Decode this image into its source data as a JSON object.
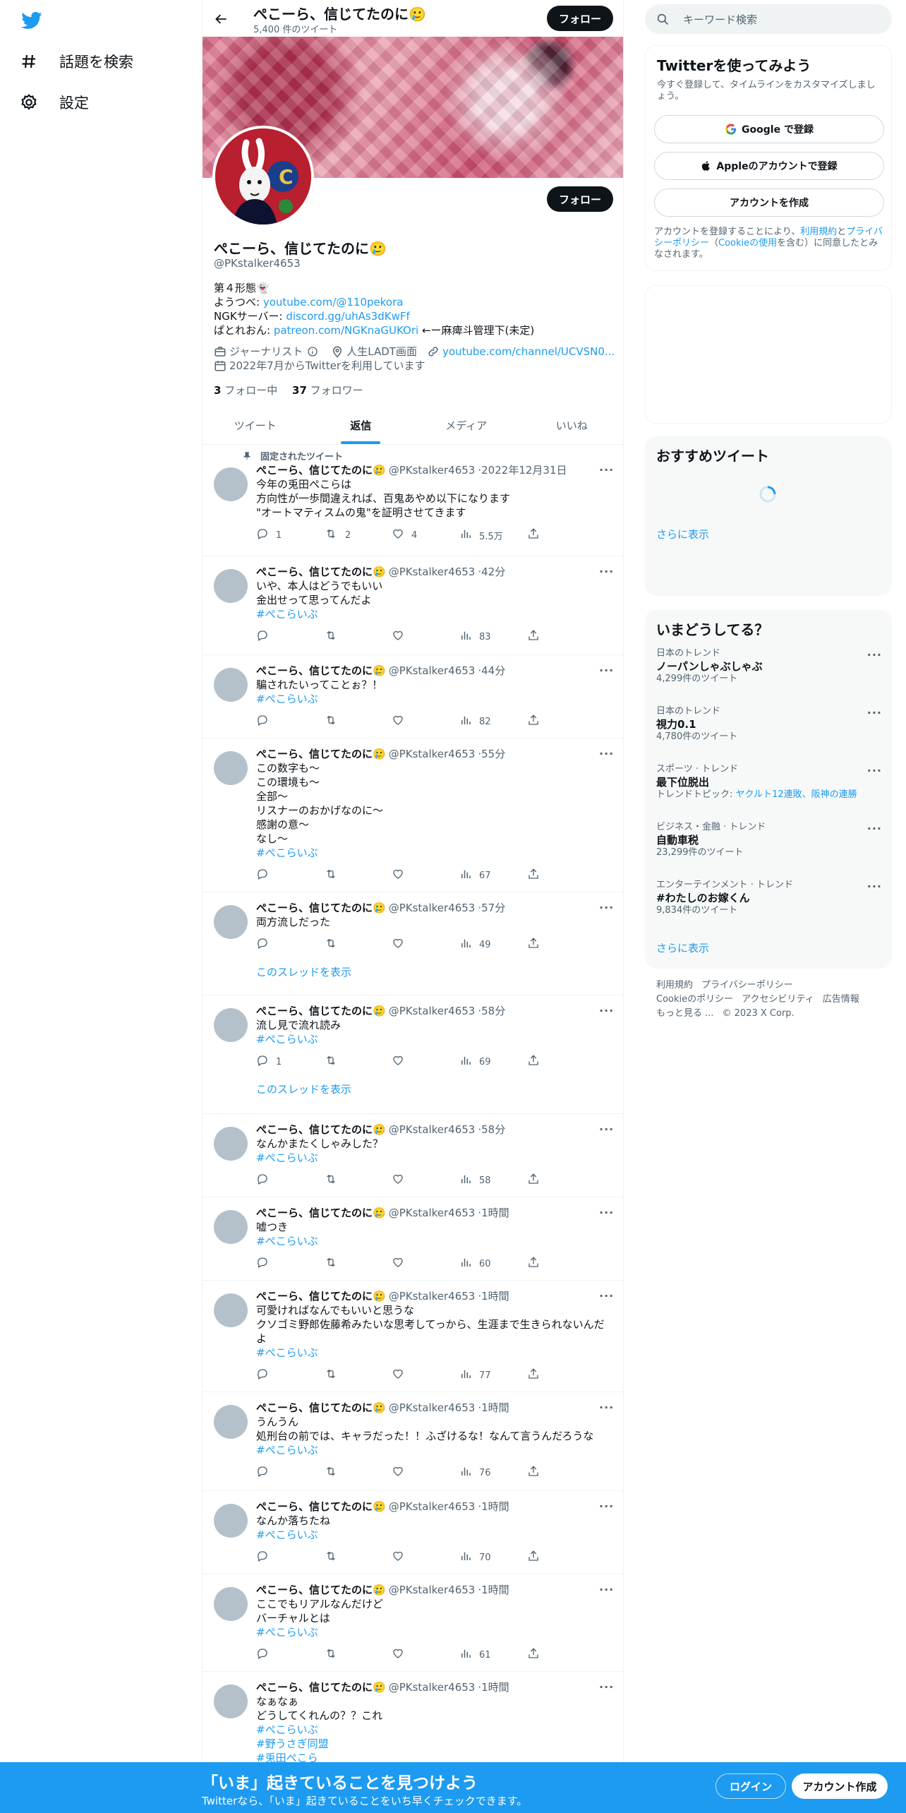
{
  "nav": {
    "explore_label": "話題を検索",
    "settings_label": "設定"
  },
  "profile": {
    "name": "ぺこーら、信じてたのに🥲",
    "tweet_count": "5,400 件のツイート",
    "follow_label": "フォロー",
    "handle": "@PKstalker4653",
    "bio": {
      "line1": "第４形態👻",
      "line2_prefix": "ようつべ: ",
      "line2_link": "youtube.com/@110pekora",
      "line3_prefix": "NGKサーバー: ",
      "line3_link": "discord.gg/uhAs3dKwFf",
      "line4_prefix": "ぱとれおん: ",
      "line4_link": "patreon.com/NGKnaGUKOri",
      "line4_suffix": " ←ー麻痺斗管理下(未定)"
    },
    "category": "ジャーナリスト",
    "location": "人生LADT画面",
    "website": "youtube.com/channel/UCVSN0...",
    "joined": "2022年7月からTwitterを利用しています",
    "following_count": "3",
    "following_label": "フォロー中",
    "followers_count": "37",
    "followers_label": "フォロワー"
  },
  "tabs": [
    "ツイート",
    "返信",
    "メディア",
    "いいね"
  ],
  "active_tab": "返信",
  "pinned_label": "固定されたツイート",
  "show_thread_label": "このスレッドを表示",
  "tweets": [
    {
      "time": "2022年12月31日",
      "lines": [
        "今年の兎田ぺこらは",
        "方向性が一歩間違えれば、百鬼あやめ以下になります",
        "\"オートマティスムの鬼\"を証明させてきます"
      ],
      "tags": [],
      "replies": "1",
      "retweets": "2",
      "likes": "4",
      "views": "5.5万"
    },
    {
      "time": "42分",
      "lines": [
        "いや、本人はどうでもいい",
        "金出せって思ってんだよ"
      ],
      "tags": [
        "#ぺこらいぶ"
      ],
      "replies": "",
      "retweets": "",
      "likes": "",
      "views": "83"
    },
    {
      "time": "44分",
      "lines": [
        "騙されたいってことぉ？！"
      ],
      "tags": [
        "#ぺこらいぶ"
      ],
      "replies": "",
      "retweets": "",
      "likes": "",
      "views": "82"
    },
    {
      "time": "55分",
      "lines": [
        "この数字も〜",
        "この環境も〜",
        "全部〜",
        "リスナーのおかげなのに〜",
        "感謝の意〜",
        "なし〜"
      ],
      "tags": [
        "#ぺこらいぶ"
      ],
      "replies": "",
      "retweets": "",
      "likes": "",
      "views": "67"
    },
    {
      "time": "57分",
      "lines": [
        "両方流しだった"
      ],
      "tags": [],
      "replies": "",
      "retweets": "",
      "likes": "",
      "views": "49"
    },
    {
      "time": "58分",
      "lines": [
        "流し見で流れ読み"
      ],
      "tags": [
        "#ぺこらいぶ"
      ],
      "replies": "1",
      "retweets": "",
      "likes": "",
      "views": "69"
    },
    {
      "time": "58分",
      "lines": [
        "なんかまたくしゃみした？"
      ],
      "tags": [
        "#ぺこらいぶ"
      ],
      "replies": "",
      "retweets": "",
      "likes": "",
      "views": "58"
    },
    {
      "time": "1時間",
      "lines": [
        "嘘つき"
      ],
      "tags": [
        "#ぺこらいぶ"
      ],
      "replies": "",
      "retweets": "",
      "likes": "",
      "views": "60"
    },
    {
      "time": "1時間",
      "lines": [
        "可愛ければなんでもいいと思うな",
        "クソゴミ野郎佐藤希みたいな思考してっから、生涯まで生きられないんだよ"
      ],
      "tags": [
        "#ぺこらいぶ"
      ],
      "replies": "",
      "retweets": "",
      "likes": "",
      "views": "77"
    },
    {
      "time": "1時間",
      "lines": [
        "うんうん",
        "処刑台の前では、キャラだった！！ふざけるな！なんて言うんだろうな"
      ],
      "tags": [
        "#ぺこらいぶ"
      ],
      "replies": "",
      "retweets": "",
      "likes": "",
      "views": "76"
    },
    {
      "time": "1時間",
      "lines": [
        "なんか落ちたね"
      ],
      "tags": [
        "#ぺこらいぶ"
      ],
      "replies": "",
      "retweets": "",
      "likes": "",
      "views": "70"
    },
    {
      "time": "1時間",
      "lines": [
        "ここでもリアルなんだけど",
        "バーチャルとは"
      ],
      "tags": [
        "#ぺこらいぶ"
      ],
      "replies": "",
      "retweets": "",
      "likes": "",
      "views": "61"
    },
    {
      "time": "1時間",
      "lines": [
        "なぁなぁ",
        "どうしてくれんの？？これ"
      ],
      "tags": [
        "#ぺこらいぶ",
        "#野うさぎ同盟",
        "#兎田ぺこら"
      ],
      "replies": "",
      "retweets": "",
      "likes": "",
      "views": ""
    }
  ],
  "search": {
    "placeholder": "キーワード検索"
  },
  "signup": {
    "title": "Twitterを使ってみよう",
    "desc": "今すぐ登録して、タイムラインをカスタマイズしましょう。",
    "google": "Google で登録",
    "apple": "Appleのアカウントで登録",
    "create": "アカウントを作成",
    "terms_1": "アカウントを登録することにより、",
    "terms_link1": "利用規約",
    "terms_2": "と",
    "terms_link2": "プライバシーポリシー",
    "terms_3": "（",
    "terms_link3": "Cookieの使用",
    "terms_4": "を含む）に同意したとみなされます。"
  },
  "recommend": {
    "title": "おすすめツイート",
    "more": "さらに表示"
  },
  "trends": {
    "title": "いまどうしてる？",
    "items": [
      {
        "category": "日本のトレンド",
        "title": "ノーパンしゃぶしゃぶ",
        "count": "4,299件のツイート",
        "extra_prefix": "",
        "extra_links": ""
      },
      {
        "category": "日本のトレンド",
        "title": "視力0.1",
        "count": "4,780件のツイート",
        "extra_prefix": "",
        "extra_links": ""
      },
      {
        "category": "スポーツ · トレンド",
        "title": "最下位脱出",
        "count": "",
        "extra_prefix": "トレンドトピック: ",
        "extra_links": "ヤクルト12連敗、阪神の連勝"
      },
      {
        "category": "ビジネス・金融 · トレンド",
        "title": "自動車税",
        "count": "23,299件のツイート",
        "extra_prefix": "",
        "extra_links": ""
      },
      {
        "category": "エンターテインメント · トレンド",
        "title": "#わたしのお嫁くん",
        "count": "9,834件のツイート",
        "extra_prefix": "",
        "extra_links": ""
      }
    ],
    "more": "さらに表示"
  },
  "footer": {
    "terms": "利用規約",
    "privacy": "プライバシーポリシー",
    "cookie": "Cookieのポリシー",
    "accessibility": "アクセシビリティ",
    "ads": "広告情報",
    "more": "もっと見る ...",
    "copyright": "© 2023 X Corp."
  },
  "bottombar": {
    "title": "「いま」起きていることを見つけよう",
    "sub": "Twitterなら、「いま」起きていることをいち早くチェックできます。",
    "login": "ログイン",
    "signup": "アカウント作成"
  },
  "colors": {
    "accent": "#1d9bf0",
    "text": "#0f1419",
    "muted": "#536471"
  }
}
